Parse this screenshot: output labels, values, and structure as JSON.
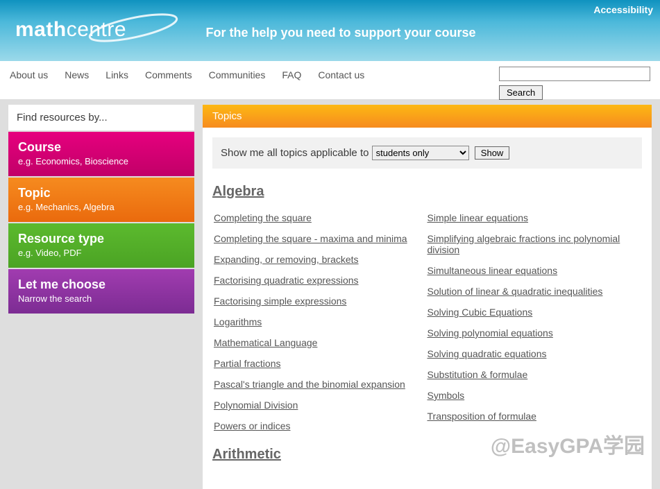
{
  "header": {
    "accessibility": "Accessibility",
    "logo_math": "math",
    "logo_centre": "centre",
    "tagline": "For the help you need to support your course"
  },
  "nav": {
    "items": [
      "About us",
      "News",
      "Links",
      "Comments",
      "Communities",
      "FAQ",
      "Contact us"
    ],
    "search_button": "Search"
  },
  "sidebar": {
    "header": "Find resources by...",
    "items": [
      {
        "title": "Course",
        "sub": "e.g. Economics, Bioscience"
      },
      {
        "title": "Topic",
        "sub": "e.g. Mechanics, Algebra"
      },
      {
        "title": "Resource type",
        "sub": "e.g. Video, PDF"
      },
      {
        "title": "Let me choose",
        "sub": "Narrow the search"
      }
    ]
  },
  "main": {
    "topics_header": "Topics",
    "filter_label": "Show me all topics applicable to ",
    "filter_selected": "students only",
    "filter_button": "Show",
    "algebra": {
      "title": "Algebra",
      "left": [
        "Completing the square",
        "Completing the square - maxima and minima",
        "Expanding, or removing, brackets",
        "Factorising quadratic expressions",
        "Factorising simple expressions",
        "Logarithms",
        "Mathematical Language",
        "Partial fractions",
        "Pascal's triangle and the binomial expansion",
        "Polynomial Division",
        "Powers or indices"
      ],
      "right": [
        "Simple linear equations",
        "Simplifying algebraic fractions inc polynomial division",
        "Simultaneous linear equations",
        "Solution of linear & quadratic inequalities",
        "Solving Cubic Equations",
        "Solving polynomial equations",
        "Solving quadratic equations",
        "Substitution & formulae",
        "Symbols",
        "Transposition of formulae"
      ]
    },
    "arithmetic": {
      "title": "Arithmetic"
    }
  },
  "watermark": "@EasyGPA学园"
}
